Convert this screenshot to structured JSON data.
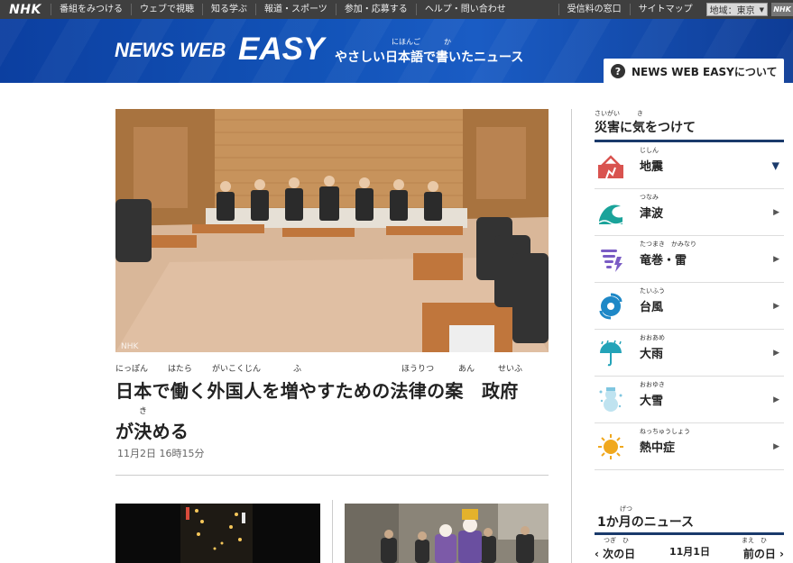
{
  "topbar": {
    "logo": "NHK",
    "nav": [
      "番組をみつける",
      "ウェブで視聴",
      "知る学ぶ",
      "報道・スポーツ",
      "参加・応募する",
      "ヘルプ・問い合わせ"
    ],
    "right_links": [
      "受信料の窓口",
      "サイトマップ"
    ],
    "region": "地域：東京",
    "mini_logo": "NHK"
  },
  "header": {
    "logo_news_web": "NEWS WEB",
    "logo_easy": "EASY",
    "tagline": "やさしい日本語で書いたニュース",
    "tagline_ruby_nihongo": "にほんご",
    "tagline_ruby_ka": "か",
    "about_label": "NEWS WEB EASYについて"
  },
  "main": {
    "ruby": {
      "r1": "にっぽん",
      "r2": "はたら",
      "r3": "がいこくじん",
      "r4": "ふ",
      "r5": "ほうりつ",
      "r6": "あん",
      "r7": "せいふ",
      "r8": "き"
    },
    "headline_line1": "日本で働く外国人を増やすための法律の案　政府",
    "headline_line2": "が決める",
    "date": "11月2日 16時15分"
  },
  "sidebar": {
    "disaster_title": "災害に気をつけて",
    "disaster_ruby_saigai": "さいがい",
    "disaster_ruby_ki": "き",
    "items": [
      {
        "label": "地震",
        "ruby": "じしん",
        "icon": "earthquake-icon",
        "color": "#d9534f",
        "expanded": true
      },
      {
        "label": "津波",
        "ruby": "つなみ",
        "icon": "tsunami-icon",
        "color": "#1aa39a",
        "expanded": false
      },
      {
        "label": "竜巻・雷",
        "ruby": "たつまき　かみなり",
        "icon": "tornado-icon",
        "color": "#7a5cc4",
        "expanded": false
      },
      {
        "label": "台風",
        "ruby": "たいふう",
        "icon": "typhoon-icon",
        "color": "#1e88c7",
        "expanded": false
      },
      {
        "label": "大雨",
        "ruby": "おおあめ",
        "icon": "umbrella-icon",
        "color": "#23a3b8",
        "expanded": false
      },
      {
        "label": "大雪",
        "ruby": "おおゆき",
        "icon": "snowman-icon",
        "color": "#7fc6e0",
        "expanded": false
      },
      {
        "label": "熱中症",
        "ruby": "ねっちゅうしょう",
        "icon": "sun-icon",
        "color": "#f0a81e",
        "expanded": false
      }
    ],
    "month_title": "1か月のニュース",
    "month_ruby": "げつ",
    "prev_label": "次の日",
    "prev_ruby": "つぎ　ひ",
    "current_date": "11月1日",
    "next_label": "前の日",
    "next_ruby": "まえ　ひ"
  },
  "colors": {
    "header_blue": "#1253b8",
    "topbar": "#3f3f3f",
    "accent_navy": "#1a3a6b"
  }
}
